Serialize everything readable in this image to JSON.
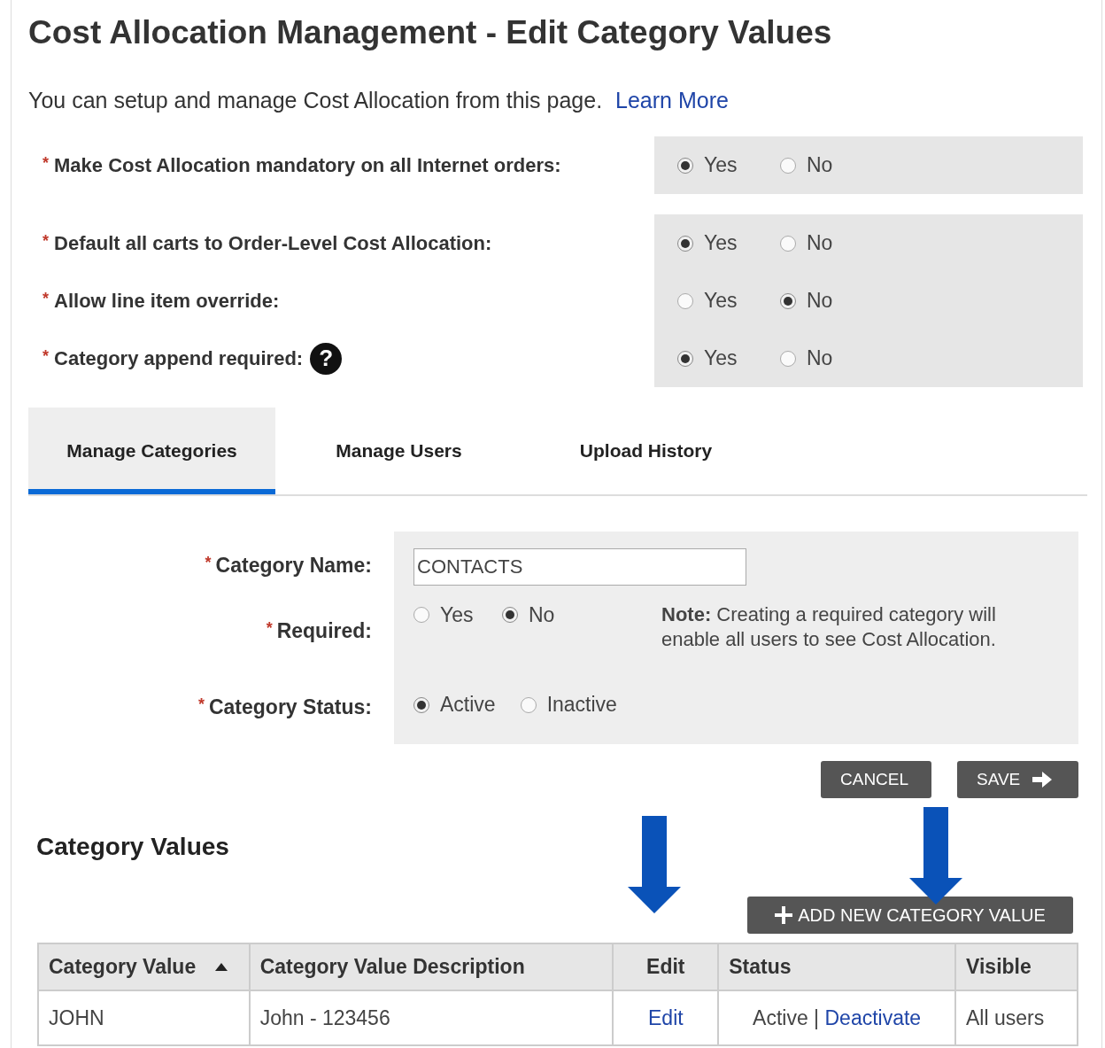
{
  "page_title": "Cost Allocation Management - Edit Category Values",
  "intro": {
    "text": "You can setup and manage Cost Allocation from this page.",
    "link": "Learn More"
  },
  "settings": {
    "panels": [
      {
        "items": [
          {
            "marker": "*",
            "label": "Make Cost Allocation mandatory on all Internet orders:",
            "options": [
              {
                "label": "Yes",
                "selected": true
              },
              {
                "label": "No",
                "selected": false
              }
            ]
          }
        ]
      },
      {
        "items": [
          {
            "marker": "*",
            "label": "Default all carts to Order-Level Cost Allocation:",
            "options": [
              {
                "label": "Yes",
                "selected": true
              },
              {
                "label": "No",
                "selected": false
              }
            ]
          },
          {
            "marker": "*",
            "label": "Allow line item override:",
            "options": [
              {
                "label": "Yes",
                "selected": false
              },
              {
                "label": "No",
                "selected": true
              }
            ]
          },
          {
            "marker": "*",
            "label": "Category append required:",
            "help_icon": "?",
            "options": [
              {
                "label": "Yes",
                "selected": true
              },
              {
                "label": "No",
                "selected": false
              }
            ]
          }
        ]
      }
    ]
  },
  "tabs": [
    {
      "label": "Manage Categories",
      "selected": true
    },
    {
      "label": "Manage Users",
      "selected": false
    },
    {
      "label": "Upload History",
      "selected": false
    }
  ],
  "category_form": {
    "name": {
      "marker": "*",
      "label": "Category Name:",
      "value": "CONTACTS"
    },
    "required": {
      "marker": "*",
      "label": "Required:",
      "options": [
        {
          "label": "Yes",
          "selected": false
        },
        {
          "label": "No",
          "selected": true
        }
      ],
      "note": "**Note:** Creating a required category will enable all users to see Cost Allocation."
    },
    "status": {
      "marker": "*",
      "label": "Category Status:",
      "options": [
        {
          "label": "Active",
          "selected": true
        },
        {
          "label": "Inactive",
          "selected": false
        }
      ]
    }
  },
  "actions": {
    "cancel": "CANCEL",
    "save": "SAVE"
  },
  "category_values": {
    "heading": "Category Values",
    "add_button": "ADD NEW CATEGORY VALUE",
    "table": {
      "columns": [
        {
          "label": "Category Value",
          "sorted": true
        },
        {
          "label": "Category Value Description",
          "sorted": false
        },
        {
          "label": "Edit",
          "sorted": false
        },
        {
          "label": "Status",
          "sorted": false
        },
        {
          "label": "Visible",
          "sorted": false
        }
      ],
      "rows": [
        {
          "category_value": "JOHN",
          "description": "John - 123456",
          "edit": "Edit",
          "status": "Active",
          "separator": "|",
          "status_action": "Deactivate",
          "visible": "All users"
        }
      ]
    }
  }
}
